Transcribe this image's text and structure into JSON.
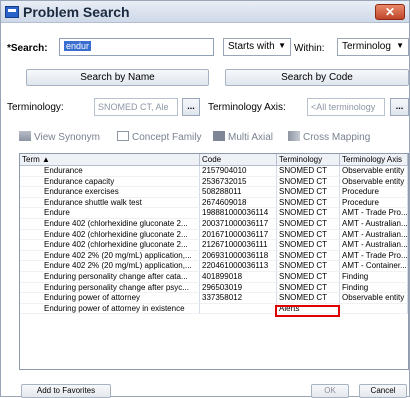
{
  "window": {
    "title": "Problem Search",
    "close_label": "✕"
  },
  "search": {
    "label": "*Search:",
    "value": "endur",
    "match_mode": "Starts with",
    "within_label": "Within:",
    "within_value": "Terminolog"
  },
  "buttons": {
    "search_by_name": "Search by Name",
    "search_by_code": "Search by Code"
  },
  "terminology": {
    "label": "Terminology:",
    "value": "SNOMED CT, Ale",
    "browse": "...",
    "axis_label": "Terminology Axis:",
    "axis_value": "<All terminology",
    "axis_browse": "..."
  },
  "toolbar": {
    "view_synonym": "View Synonym",
    "concept_family": "Concept Family",
    "multi_axial": "Multi Axial",
    "cross_mapping": "Cross Mapping"
  },
  "table": {
    "columns": [
      "Term ▲",
      "Code",
      "Terminology",
      "Terminology Axis"
    ],
    "rows": [
      [
        "Endurance",
        "2157904010",
        "SNOMED CT",
        "Observable entity"
      ],
      [
        "Endurance capacity",
        "2536732015",
        "SNOMED CT",
        "Observable entity"
      ],
      [
        "Endurance exercises",
        "508288011",
        "SNOMED CT",
        "Procedure"
      ],
      [
        "Endurance shuttle walk test",
        "2674609018",
        "SNOMED CT",
        "Procedure"
      ],
      [
        "Endure",
        "198881000036114",
        "SNOMED CT",
        "AMT - Trade Pro..."
      ],
      [
        "Endure 402 (chlorhexidine gluconate 2...",
        "200371000036117",
        "SNOMED CT",
        "AMT - Australian..."
      ],
      [
        "Endure 402 (chlorhexidine gluconate 2...",
        "201671000036117",
        "SNOMED CT",
        "AMT - Australian..."
      ],
      [
        "Endure 402 (chlorhexidine gluconate 2...",
        "212671000036111",
        "SNOMED CT",
        "AMT - Australian..."
      ],
      [
        "Endure 402 2% (20 mg/mL) application,...",
        "206931000036118",
        "SNOMED CT",
        "AMT - Trade Pro..."
      ],
      [
        "Endure 402 2% (20 mg/mL) application,...",
        "220461000036113",
        "SNOMED CT",
        "AMT - Container..."
      ],
      [
        "Enduring personality change after cata...",
        "401899018",
        "SNOMED CT",
        "Finding"
      ],
      [
        "Enduring personality change after psyc...",
        "296503019",
        "SNOMED CT",
        "Finding"
      ],
      [
        "Enduring power of attorney",
        "337358012",
        "SNOMED CT",
        "Observable entity"
      ],
      [
        "Enduring power of attorney in existence",
        "",
        "Alerts",
        ""
      ]
    ]
  },
  "footer": {
    "add_to_favorites": "Add to Favorites",
    "ok": "OK",
    "cancel": "Cancel"
  }
}
